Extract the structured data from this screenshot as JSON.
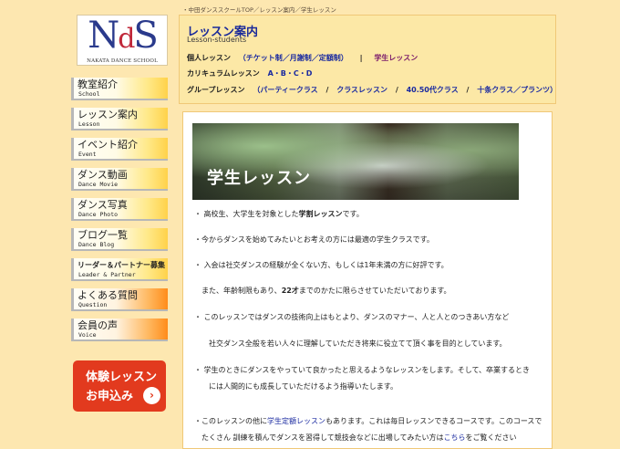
{
  "logo": {
    "main_n": "N",
    "main_d": "d",
    "main_s": "S",
    "sub": "NAKATA DANCE SCHOOL"
  },
  "breadcrumb": {
    "items": [
      "・中田ダンススクールTOP",
      "レッスン案内",
      "学生レッスン"
    ],
    "separator": "／"
  },
  "nav": {
    "items": [
      {
        "jp": "教室紹介",
        "en": "School"
      },
      {
        "jp": "レッスン案内",
        "en": "Lesson"
      },
      {
        "jp": "イベント紹介",
        "en": "Event"
      },
      {
        "jp": "ダンス動画",
        "en": "Dance Movie"
      },
      {
        "jp": "ダンス写真",
        "en": "Dance Photo"
      },
      {
        "jp": "ブログ一覧",
        "en": "Dance Blog"
      },
      {
        "jp": "リーダー＆パートナー募集",
        "en": "Leader & Partner"
      },
      {
        "jp": "よくある質問",
        "en": "Question"
      },
      {
        "jp": "会員の声",
        "en": "Voice"
      }
    ]
  },
  "trial": {
    "line1": "体験レッスン",
    "line2": "お申込み",
    "arrow": "›"
  },
  "header": {
    "title": "レッスン案内",
    "subtitle": "Lesson-students",
    "row1": {
      "label": "個人レッスン",
      "link": "（チケット制／月謝制／定額制）",
      "sep": "|",
      "link2": "学生レッスン"
    },
    "row2": {
      "label": "カリキュラムレッスン",
      "link": "A・B・C・D"
    },
    "row3": {
      "label": "グループレッスン",
      "links": [
        "（パーティークラス",
        "クラスレッスン",
        "40.50代クラス",
        "十条クラス／プランツ）"
      ],
      "sep": "/"
    }
  },
  "content": {
    "banner_text": "学生レッスン",
    "p1_pre": "・ 高校生、大学生を対象とした",
    "p1_bold": "学割レッスン",
    "p1_post": "です。",
    "p2": "・今からダンスを始めてみたいとお考えの方には最適の学生クラスです。",
    "p3": "・ 入会は社交ダンスの経験が全くない方、もしくは1年未満の方に好評です。",
    "p4_pre": "　また、年齢制限もあり、",
    "p4_bold": "22才",
    "p4_post": "までのかたに限らさせていただいております。",
    "p5": "・ このレッスンではダンスの技術向上はもとより、ダンスのマナー、人と人とのつきあい方など",
    "p6": "　　社交ダンス全般を若い人々に理解していただき将来に役立てて頂く事を目的としています。",
    "p7": "・ 学生のときにダンスをやっていて良かったと思えるようなレッスンをします。そして、卒業するとき",
    "p8": "　　には人間的にも成長していただけるよう指導いたします。",
    "p9_pre": "・このレッスンの他に",
    "p9_link": "学生定額レッスン",
    "p9_post": "もあります。これは毎日レッスンできるコースです。このコースで",
    "p10_pre": "　たくさん 訓練を積んでダンスを習得して競技会などに出場してみたい方は",
    "p10_link": "こちら",
    "p10_post": "をご覧ください"
  },
  "colors": {
    "page_bg": "#fde7b0",
    "title_blue": "#1a2a9a",
    "trial_red": "#e23a1e",
    "nav_yellow": "#ffd24a",
    "nav_orange": "#ff8c1a"
  }
}
